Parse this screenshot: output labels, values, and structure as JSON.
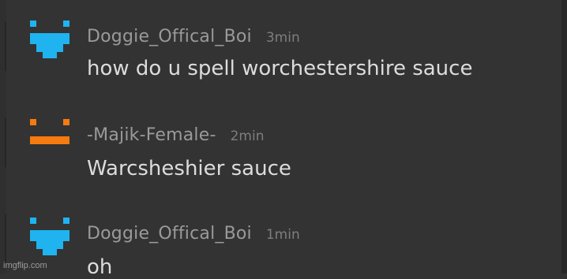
{
  "messages": [
    {
      "username": "Doggie_Offical_Boi",
      "time": "3min",
      "text": "how do u spell worchestershire sauce",
      "avatar_icon": "pixel-face-icon",
      "avatar_color": "#1fb3ef"
    },
    {
      "username": "-Majik-Female-",
      "time": "2min",
      "text": "Warcsheshier sauce",
      "avatar_icon": "pixel-face-icon",
      "avatar_color": "#f57a10"
    },
    {
      "username": "Doggie_Offical_Boi",
      "time": "1min",
      "text": "oh",
      "avatar_icon": "pixel-face-icon",
      "avatar_color": "#1fb3ef"
    }
  ],
  "watermark": "imgflip.com"
}
